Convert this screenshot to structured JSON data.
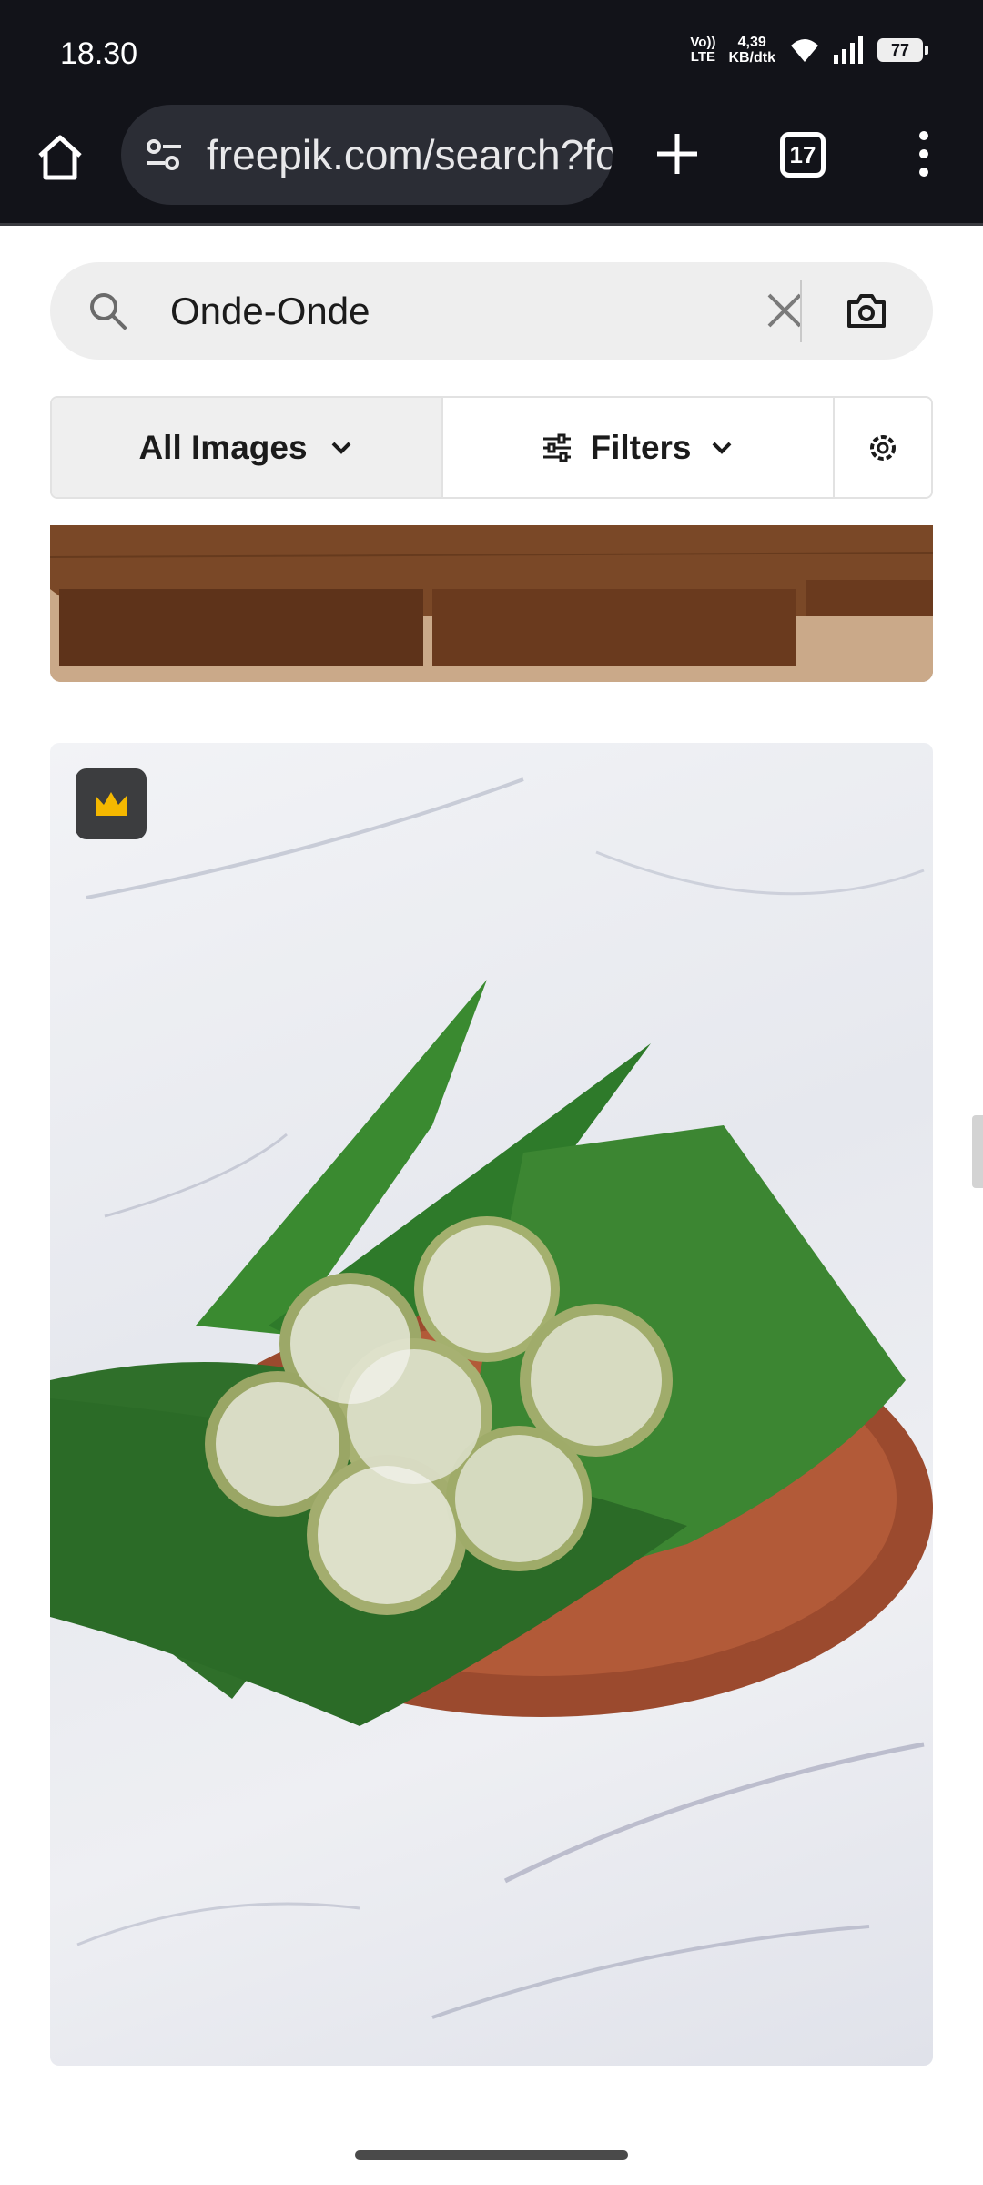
{
  "status_bar": {
    "time": "18.30",
    "volte_top": "Vo))",
    "volte_bottom": "LTE",
    "net_speed_value": "4,39",
    "net_speed_unit": "KB/dtk",
    "battery": "77"
  },
  "browser": {
    "url": "freepik.com/search?format=search&query=Onde-Onde",
    "tab_count": "17",
    "icons": [
      "home-icon",
      "site-settings-icon",
      "new-tab-icon",
      "tabs-icon",
      "more-vert-icon"
    ]
  },
  "search": {
    "query": "Onde-Onde",
    "icons": [
      "search-icon",
      "clear-icon",
      "camera-icon"
    ]
  },
  "filters": {
    "type_label": "All Images",
    "filters_label": "Filters",
    "icons": [
      "chevron-down-icon",
      "sliders-icon",
      "gear-icon"
    ]
  },
  "results": {
    "badge_icon": "crown-icon",
    "badge_color": "#f5b800"
  }
}
